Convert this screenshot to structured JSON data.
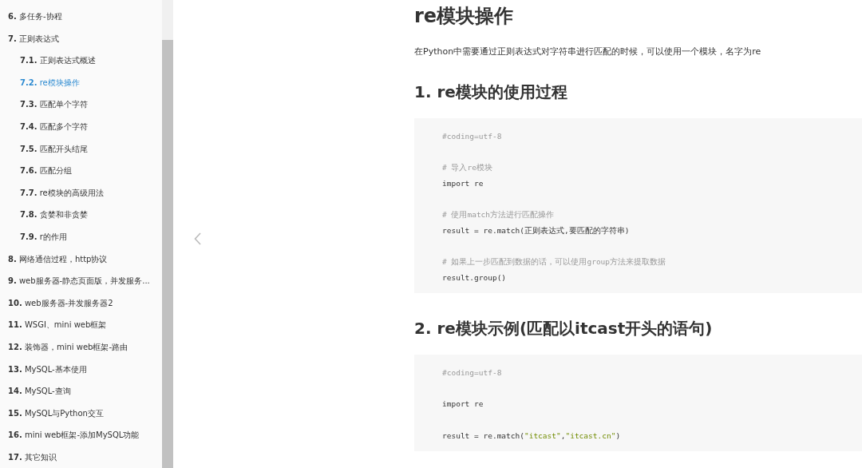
{
  "toc": [
    {
      "number": "6.",
      "title": "多任务-协程",
      "selected": false
    },
    {
      "number": "7.",
      "title": "正则表达式",
      "selected": false,
      "children": [
        {
          "number": "7.1.",
          "title": "正则表达式概述",
          "selected": false
        },
        {
          "number": "7.2.",
          "title": "re模块操作",
          "selected": true
        },
        {
          "number": "7.3.",
          "title": "匹配单个字符",
          "selected": false
        },
        {
          "number": "7.4.",
          "title": "匹配多个字符",
          "selected": false
        },
        {
          "number": "7.5.",
          "title": "匹配开头结尾",
          "selected": false
        },
        {
          "number": "7.6.",
          "title": "匹配分组",
          "selected": false
        },
        {
          "number": "7.7.",
          "title": "re模块的高级用法",
          "selected": false
        },
        {
          "number": "7.8.",
          "title": "贪婪和非贪婪",
          "selected": false
        },
        {
          "number": "7.9.",
          "title": "r的作用",
          "selected": false
        }
      ]
    },
    {
      "number": "8.",
      "title": "网络通信过程，http协议",
      "selected": false
    },
    {
      "number": "9.",
      "title": "web服务器-静态页面版，并发服务...",
      "selected": false
    },
    {
      "number": "10.",
      "title": "web服务器-并发服务器2",
      "selected": false
    },
    {
      "number": "11.",
      "title": "WSGI、mini web框架",
      "selected": false
    },
    {
      "number": "12.",
      "title": "装饰器，mini web框架-路由",
      "selected": false
    },
    {
      "number": "13.",
      "title": "MySQL-基本使用",
      "selected": false
    },
    {
      "number": "14.",
      "title": "MySQL-查询",
      "selected": false
    },
    {
      "number": "15.",
      "title": "MySQL与Python交互",
      "selected": false
    },
    {
      "number": "16.",
      "title": "mini web框架-添加MySQL功能",
      "selected": false
    },
    {
      "number": "17.",
      "title": "其它知识",
      "selected": false
    }
  ],
  "article": {
    "title": "re模块操作",
    "intro": "在Python中需要通过正则表达式对字符串进行匹配的时候，可以使用一个模块，名字为re",
    "sections": [
      {
        "heading": "1. re模块的使用过程",
        "code": [
          {
            "kind": "comment",
            "text": "#coding=utf-8"
          },
          {
            "kind": "blank"
          },
          {
            "kind": "comment",
            "text": "# 导入re模块"
          },
          {
            "kind": "code",
            "segments": [
              {
                "kind": "plain",
                "text": "import re"
              }
            ]
          },
          {
            "kind": "blank"
          },
          {
            "kind": "comment",
            "text": "# 使用match方法进行匹配操作"
          },
          {
            "kind": "code",
            "segments": [
              {
                "kind": "plain",
                "text": "result = re.match(正则表达式,要匹配的字符串)"
              }
            ]
          },
          {
            "kind": "blank"
          },
          {
            "kind": "comment",
            "text": "# 如果上一步匹配到数据的话，可以使用group方法来提取数据"
          },
          {
            "kind": "code",
            "segments": [
              {
                "kind": "plain",
                "text": "result.group()"
              }
            ]
          }
        ]
      },
      {
        "heading": "2. re模块示例(匹配以itcast开头的语句)",
        "code": [
          {
            "kind": "comment",
            "text": "#coding=utf-8"
          },
          {
            "kind": "blank"
          },
          {
            "kind": "code",
            "segments": [
              {
                "kind": "plain",
                "text": "import re"
              }
            ]
          },
          {
            "kind": "blank"
          },
          {
            "kind": "code",
            "segments": [
              {
                "kind": "plain",
                "text": "result = re.match("
              },
              {
                "kind": "string",
                "text": "\"itcast\""
              },
              {
                "kind": "plain",
                "text": ","
              },
              {
                "kind": "string",
                "text": "\"itcast.cn\""
              },
              {
                "kind": "plain",
                "text": ")"
              }
            ]
          }
        ]
      }
    ]
  }
}
